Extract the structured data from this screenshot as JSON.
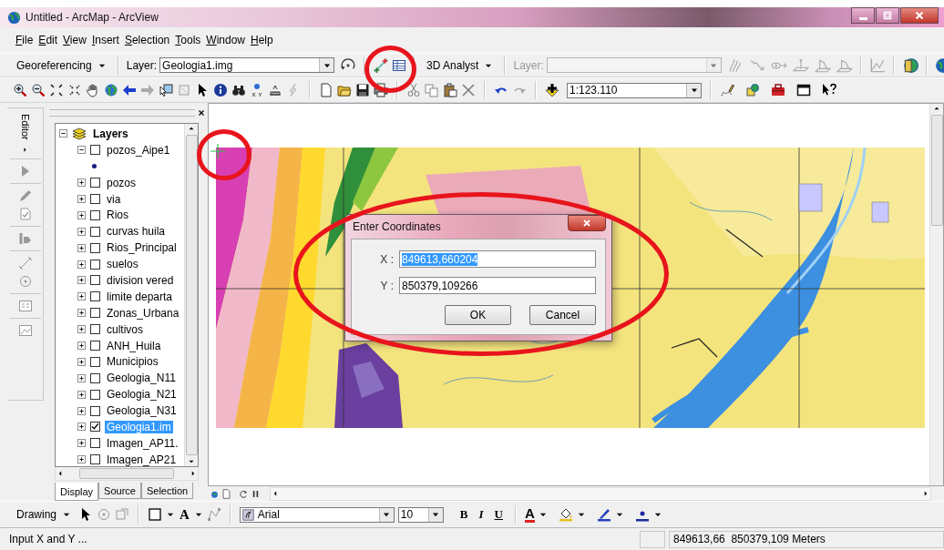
{
  "window": {
    "title": "Untitled - ArcMap - ArcView"
  },
  "menu": [
    "File",
    "Edit",
    "View",
    "Insert",
    "Selection",
    "Tools",
    "Window",
    "Help"
  ],
  "georeferencing": {
    "menu": "Georeferencing",
    "layer_label": "Layer:",
    "layer": "Geologia1.img"
  },
  "analyst": {
    "menu": "3D Analyst",
    "layer_label": "Layer:",
    "disabled": true
  },
  "standard": {
    "scale": "1:123.110"
  },
  "editor": {
    "title": "Editor"
  },
  "toc": {
    "root": "Layers",
    "layers": [
      {
        "name": "pozos_Aipe1",
        "checked": false,
        "expanded": true,
        "selected": false
      },
      {
        "name": "pozos",
        "checked": false,
        "expanded": false,
        "selected": false
      },
      {
        "name": "via",
        "checked": false,
        "expanded": false,
        "selected": false
      },
      {
        "name": "Rios",
        "checked": false,
        "expanded": false,
        "selected": false
      },
      {
        "name": "curvas huila",
        "checked": false,
        "expanded": false,
        "selected": false
      },
      {
        "name": "Rios_Principal",
        "checked": false,
        "expanded": false,
        "selected": false
      },
      {
        "name": "suelos",
        "checked": false,
        "expanded": false,
        "selected": false
      },
      {
        "name": "division vered",
        "checked": false,
        "expanded": false,
        "selected": false
      },
      {
        "name": "limite departa",
        "checked": false,
        "expanded": false,
        "selected": false
      },
      {
        "name": "Zonas_Urbana",
        "checked": false,
        "expanded": false,
        "selected": false
      },
      {
        "name": "cultivos",
        "checked": false,
        "expanded": false,
        "selected": false
      },
      {
        "name": "ANH_Huila",
        "checked": false,
        "expanded": false,
        "selected": false
      },
      {
        "name": "Municipios",
        "checked": false,
        "expanded": false,
        "selected": false
      },
      {
        "name": "Geologia_N11",
        "checked": false,
        "expanded": false,
        "selected": false
      },
      {
        "name": "Geologia_N21",
        "checked": false,
        "expanded": false,
        "selected": false
      },
      {
        "name": "Geologia_N31",
        "checked": false,
        "expanded": false,
        "selected": false
      },
      {
        "name": "Geologia1.im",
        "checked": true,
        "expanded": false,
        "selected": true
      },
      {
        "name": "Imagen_AP11.",
        "checked": false,
        "expanded": false,
        "selected": false
      },
      {
        "name": "Imagen_AP21",
        "checked": false,
        "expanded": false,
        "selected": false
      }
    ],
    "tabs": [
      {
        "label": "Display",
        "selected": true
      },
      {
        "label": "Source",
        "selected": false
      },
      {
        "label": "Selection",
        "selected": false
      }
    ]
  },
  "dialog": {
    "title": "Enter Coordinates",
    "fields": [
      {
        "label": "X :",
        "value": "849613,660204",
        "selected": true
      },
      {
        "label": "Y :",
        "value": "850379,109266",
        "selected": false
      }
    ],
    "buttons": [
      "OK",
      "Cancel"
    ]
  },
  "drawing": {
    "menu": "Drawing",
    "text_tool": "A",
    "font": "Arial",
    "size": "10",
    "styles": [
      "B",
      "I",
      "U"
    ],
    "font_color": "A"
  },
  "status_bar": {
    "message": "Input X and Y ...",
    "coordinates": "849613,66  850379,109 Meters"
  }
}
